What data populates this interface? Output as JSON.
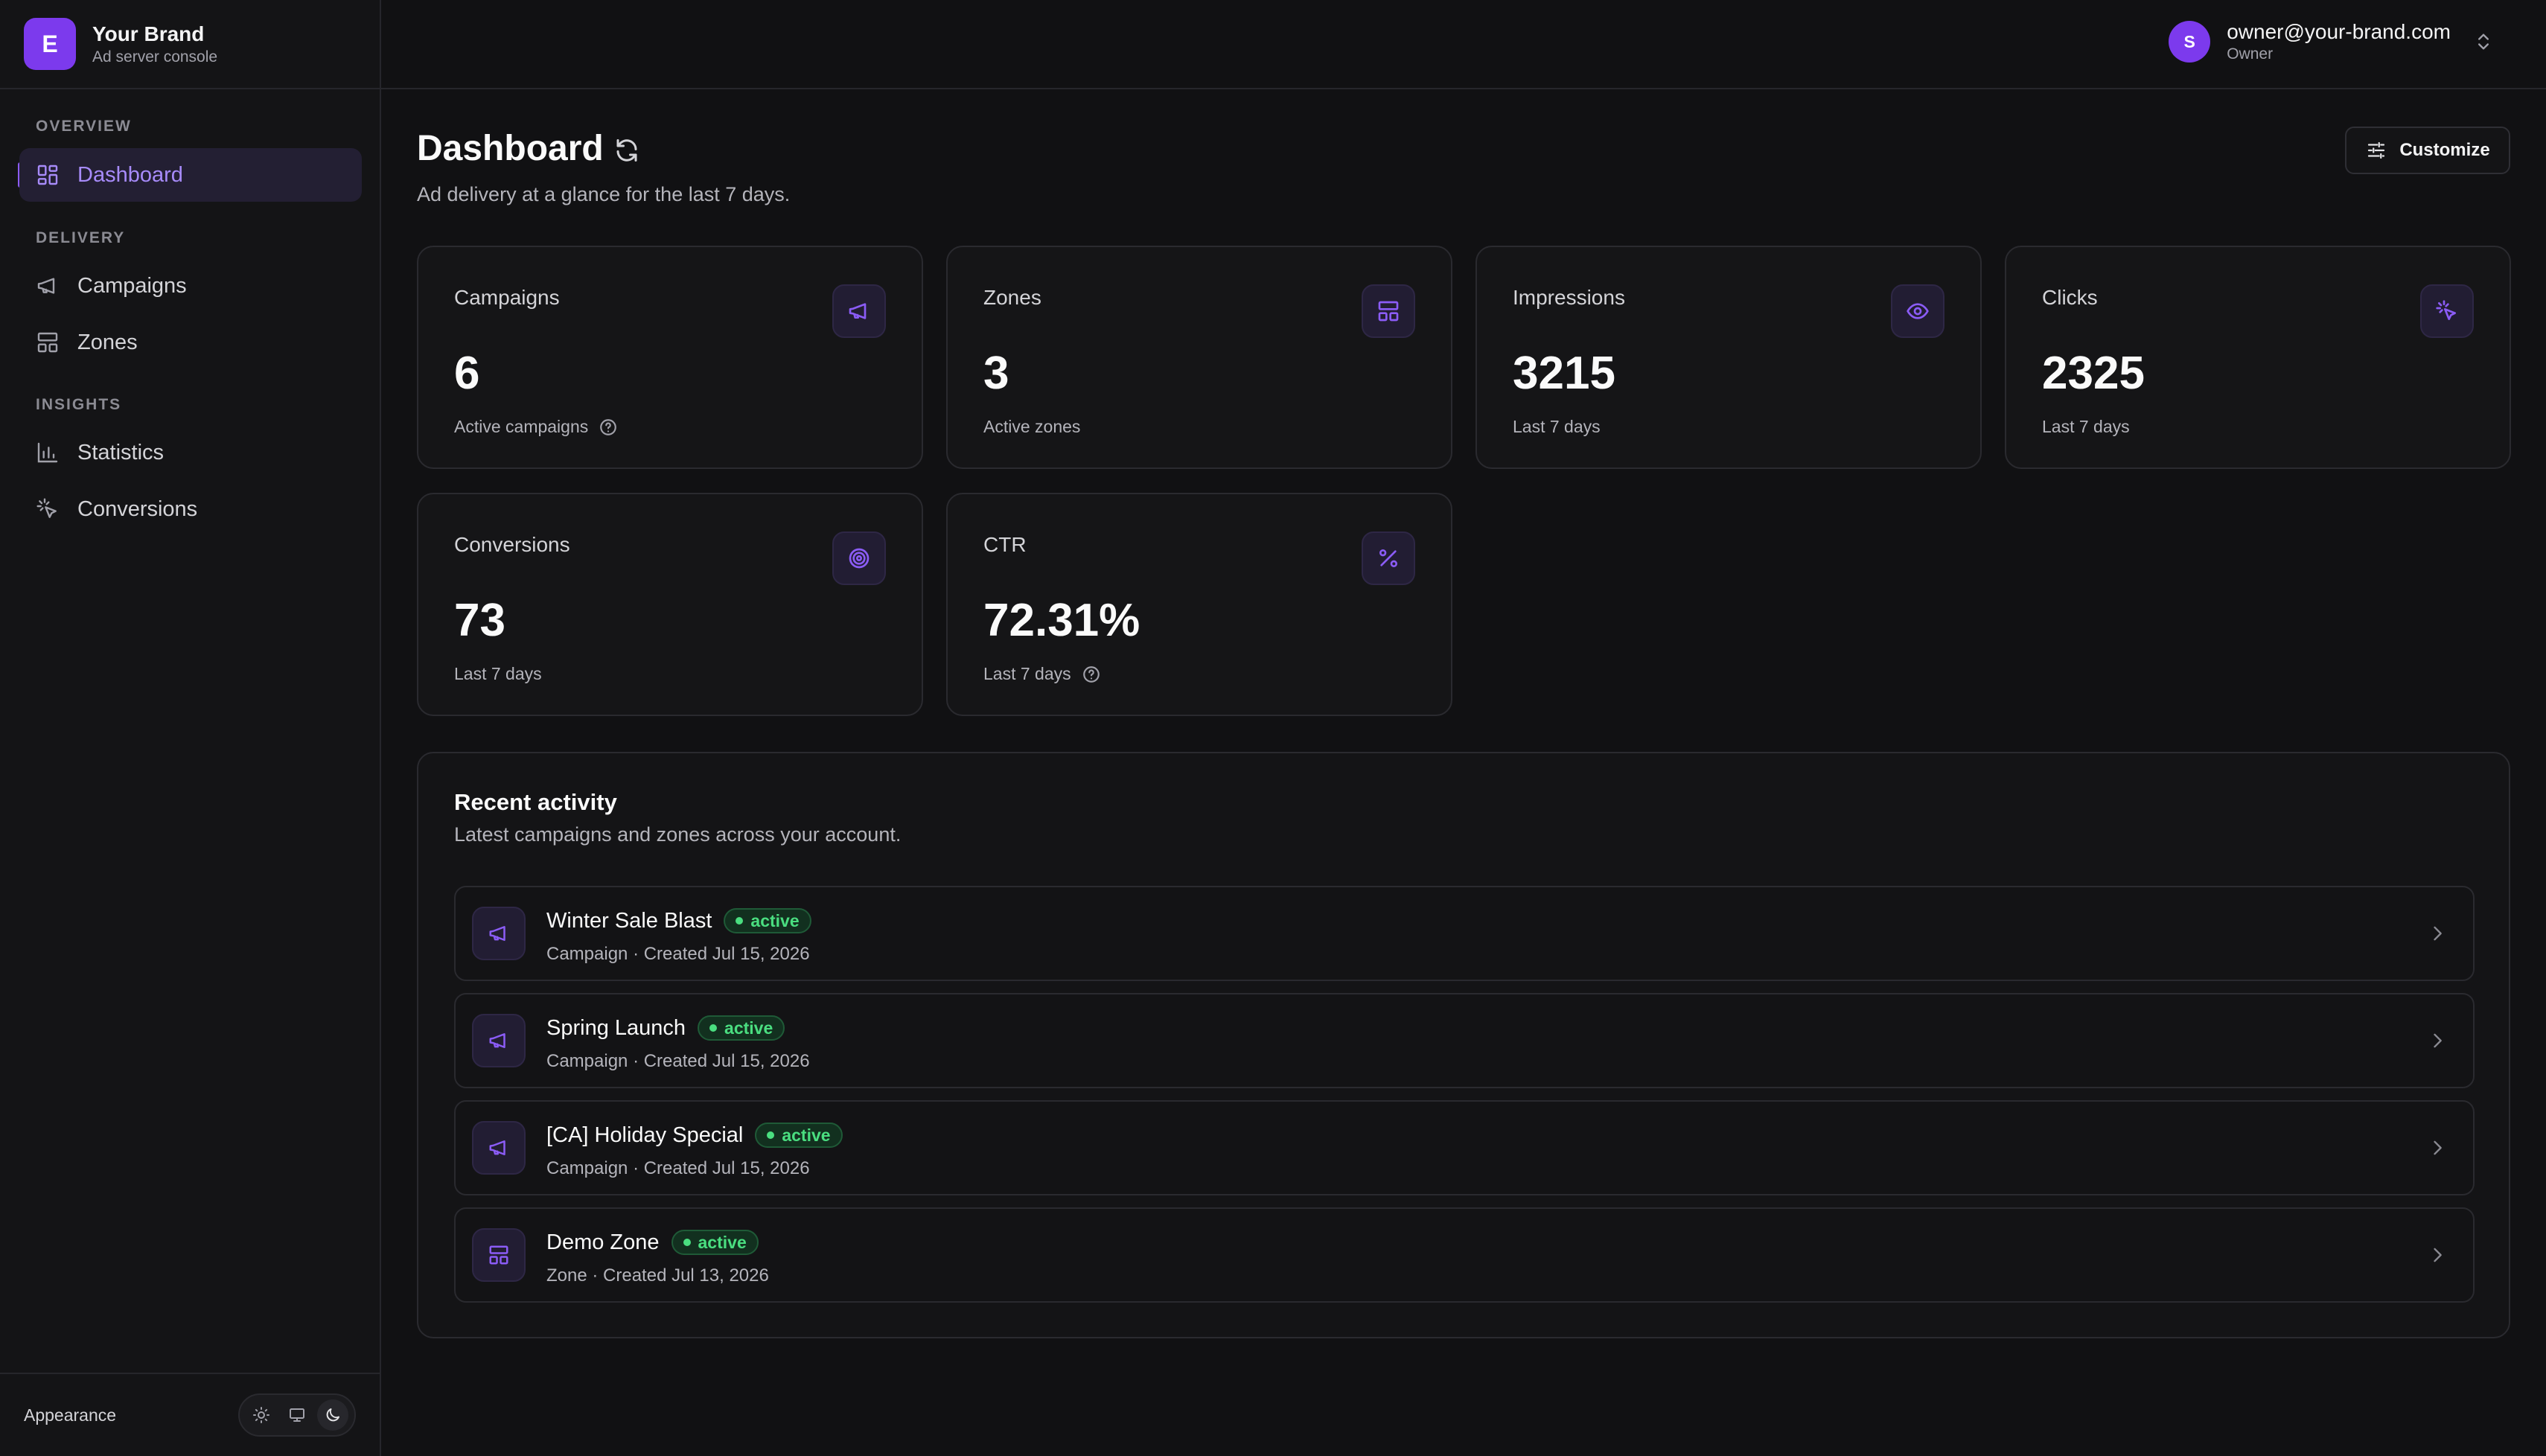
{
  "brand": {
    "initial": "E",
    "name": "Your Brand",
    "subtitle": "Ad server console"
  },
  "sidebar": {
    "sections": [
      {
        "title": "OVERVIEW",
        "items": [
          {
            "label": "Dashboard",
            "icon": "grid-icon",
            "active": true
          }
        ]
      },
      {
        "title": "DELIVERY",
        "items": [
          {
            "label": "Campaigns",
            "icon": "megaphone-icon"
          },
          {
            "label": "Zones",
            "icon": "layout-icon"
          }
        ]
      },
      {
        "title": "INSIGHTS",
        "items": [
          {
            "label": "Statistics",
            "icon": "bar-chart-icon"
          },
          {
            "label": "Conversions",
            "icon": "cursor-click-icon"
          }
        ]
      }
    ],
    "appearance_label": "Appearance",
    "theme_options": [
      "light",
      "system",
      "dark"
    ],
    "theme_selected": "dark"
  },
  "user": {
    "initial": "S",
    "email": "owner@your-brand.com",
    "role": "Owner"
  },
  "page": {
    "title": "Dashboard",
    "subtitle": "Ad delivery at a glance for the last 7 days.",
    "customize_label": "Customize"
  },
  "stats": [
    {
      "label": "Campaigns",
      "value": "6",
      "note": "Active campaigns",
      "icon": "megaphone-icon",
      "help": true
    },
    {
      "label": "Zones",
      "value": "3",
      "note": "Active zones",
      "icon": "layout-icon",
      "help": false
    },
    {
      "label": "Impressions",
      "value": "3215",
      "note": "Last 7 days",
      "icon": "eye-icon",
      "help": false
    },
    {
      "label": "Clicks",
      "value": "2325",
      "note": "Last 7 days",
      "icon": "cursor-click-icon",
      "help": false
    },
    {
      "label": "Conversions",
      "value": "73",
      "note": "Last 7 days",
      "icon": "target-icon",
      "help": false
    },
    {
      "label": "CTR",
      "value": "72.31%",
      "note": "Last 7 days",
      "icon": "percent-icon",
      "help": true
    }
  ],
  "recent": {
    "title": "Recent activity",
    "subtitle": "Latest campaigns and zones across your account.",
    "items": [
      {
        "name": "Winter Sale Blast",
        "status": "active",
        "meta": "Campaign · Created Jul 15, 2026",
        "icon": "megaphone-icon"
      },
      {
        "name": "Spring Launch",
        "status": "active",
        "meta": "Campaign · Created Jul 15, 2026",
        "icon": "megaphone-icon"
      },
      {
        "name": "[CA] Holiday Special",
        "status": "active",
        "meta": "Campaign · Created Jul 15, 2026",
        "icon": "megaphone-icon"
      },
      {
        "name": "Demo Zone",
        "status": "active",
        "meta": "Zone · Created Jul 13, 2026",
        "icon": "layout-icon"
      }
    ]
  },
  "colors": {
    "accent": "#8b5cf6",
    "success": "#4ade80",
    "background": "#111113"
  }
}
